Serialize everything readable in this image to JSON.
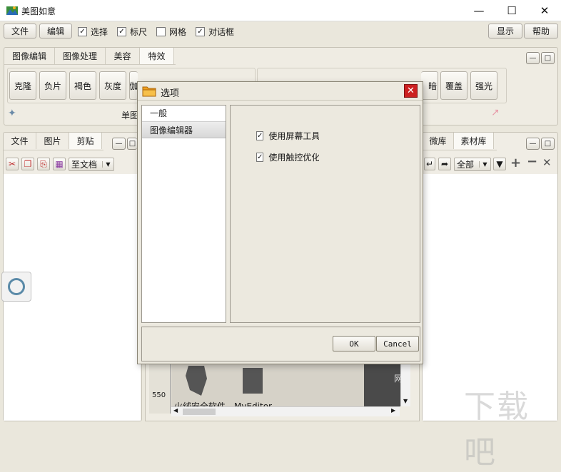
{
  "window": {
    "title": "美图如意"
  },
  "menubar": {
    "file": "文件",
    "edit": "编辑",
    "checks": [
      {
        "label": "选择",
        "checked": true
      },
      {
        "label": "标尺",
        "checked": true
      },
      {
        "label": "网格",
        "checked": false
      },
      {
        "label": "对话框",
        "checked": true
      }
    ],
    "show": "显示",
    "help": "帮助"
  },
  "effects_panel": {
    "tabs": [
      "图像编辑",
      "图像处理",
      "美容",
      "特效"
    ],
    "active_tab": 3,
    "buttons_left": [
      "克隆",
      "负片",
      "褐色",
      "灰度",
      "伽"
    ],
    "buttons_right": [
      "暗",
      "覆盖",
      "强光"
    ],
    "footer_text": "单图"
  },
  "left_panel": {
    "tabs": [
      "文件",
      "图片",
      "剪贴"
    ],
    "active_tab": 2,
    "dropdown": "至文档"
  },
  "right_panel": {
    "tabs": [
      "微库",
      "素材库"
    ],
    "active_tab": 1,
    "dropdown": "全部"
  },
  "canvas": {
    "ruler_label": "550",
    "items": [
      "火绒安全软件",
      "MyEditor"
    ],
    "partial_text": "网"
  },
  "dialog": {
    "title": "选项",
    "nav": [
      "一般",
      "图像编辑器"
    ],
    "selected_nav": 1,
    "options": [
      {
        "label": "使用屏幕工具",
        "checked": true
      },
      {
        "label": "使用触控优化",
        "checked": true
      }
    ],
    "ok": "OK",
    "cancel": "Cancel"
  },
  "colors": {
    "close_red": "#cc2020",
    "folder_orange": "#f0a020"
  }
}
